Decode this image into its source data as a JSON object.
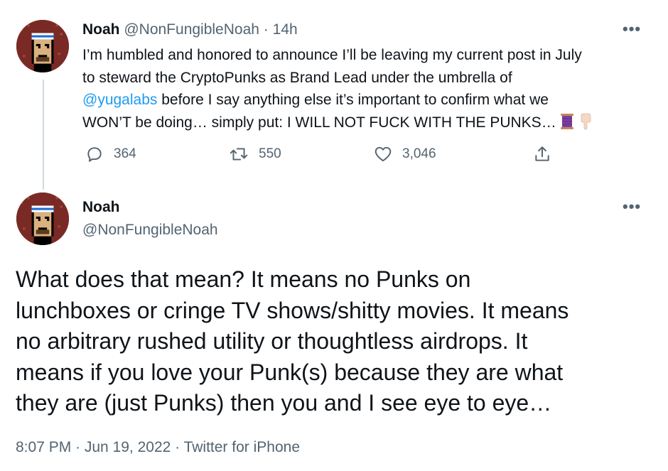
{
  "tweet1": {
    "author_name": "Noah",
    "handle": "@NonFungibleNoah",
    "separator": "·",
    "time_ago": "14h",
    "more_label": "•••",
    "text_lines": [
      "I’m humbled and honored to announce I’ll be leaving my current post in July",
      "to steward the CryptoPunks as Brand Lead under the umbrella of"
    ],
    "mention": "@yugalabs",
    "line3_rest": " before I say anything else it’s important to confirm what we",
    "line4": "WON’T be doing… simply put: I WILL NOT FUCK WITH THE PUNKS…",
    "emoji_icons": [
      "spool-of-thread-icon",
      "pointing-down-icon"
    ],
    "reply_count": "364",
    "retweet_count": "550",
    "like_count": "3,046"
  },
  "tweet2": {
    "author_name": "Noah",
    "handle": "@NonFungibleNoah",
    "more_label": "•••",
    "text_lines": [
      "What does that mean? It means no Punks on",
      "lunchboxes or cringe TV shows/shitty movies. It means",
      "no arbitrary rushed utility or thoughtless airdrops. It",
      "means if you love your Punk(s) because they are what",
      "they are (just Punks) then you and I see eye to eye…"
    ],
    "timestamp": "8:07 PM · Jun 19, 2022 · Twitter for iPhone"
  },
  "colors": {
    "text": "#0f1419",
    "muted": "#536471",
    "link": "#1d9bf0",
    "thread_line": "#cfd9de"
  }
}
